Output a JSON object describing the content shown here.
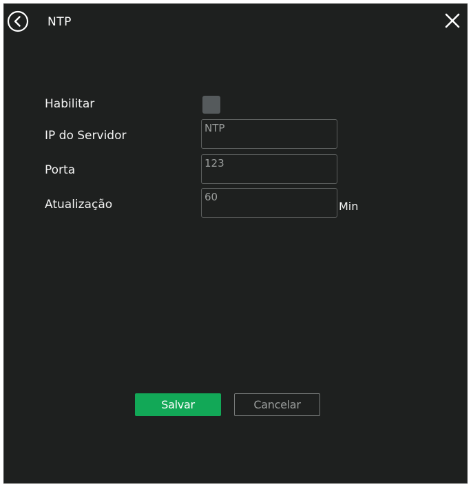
{
  "header": {
    "title": "NTP",
    "back_icon": "chevron-left-circle-icon",
    "close_icon": "close-icon"
  },
  "form": {
    "enable_label": "Habilitar",
    "enable_checked": false,
    "server_label": "IP do Servidor",
    "server_value": "NTP",
    "port_label": "Porta",
    "port_value": "123",
    "update_label": "Atualização",
    "update_value": "60",
    "update_unit": "Min"
  },
  "actions": {
    "save_label": "Salvar",
    "cancel_label": "Cancelar"
  },
  "colors": {
    "background": "#1e201f",
    "accent": "#12a857",
    "checkbox": "#555a5c"
  }
}
